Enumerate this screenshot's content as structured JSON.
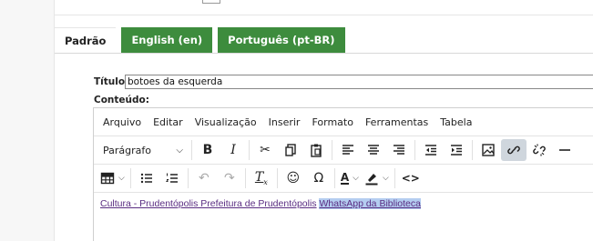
{
  "tabs": [
    {
      "label": "Padrão",
      "active": true
    },
    {
      "label": "English (en)",
      "active": false
    },
    {
      "label": "Português (pt-BR)",
      "active": false
    }
  ],
  "form": {
    "title_label": "Título:",
    "title_value": "botoes da esquerda",
    "content_label": "Conteúdo:"
  },
  "editor": {
    "menu": [
      "Arquivo",
      "Editar",
      "Visualização",
      "Inserir",
      "Formato",
      "Ferramentas",
      "Tabela"
    ],
    "block_format": "Parágrafo",
    "links": [
      {
        "text": "Cultura - Prudentópolis Prefeitura de Prudentópolis"
      },
      {
        "text": "WhatsApp da Biblioteca",
        "selected": true
      }
    ]
  },
  "colors": {
    "tab_green": "#3d8c3d",
    "link": "#5a2d82",
    "selection": "#b4cdf0",
    "active_button": "#cfd6dd"
  }
}
